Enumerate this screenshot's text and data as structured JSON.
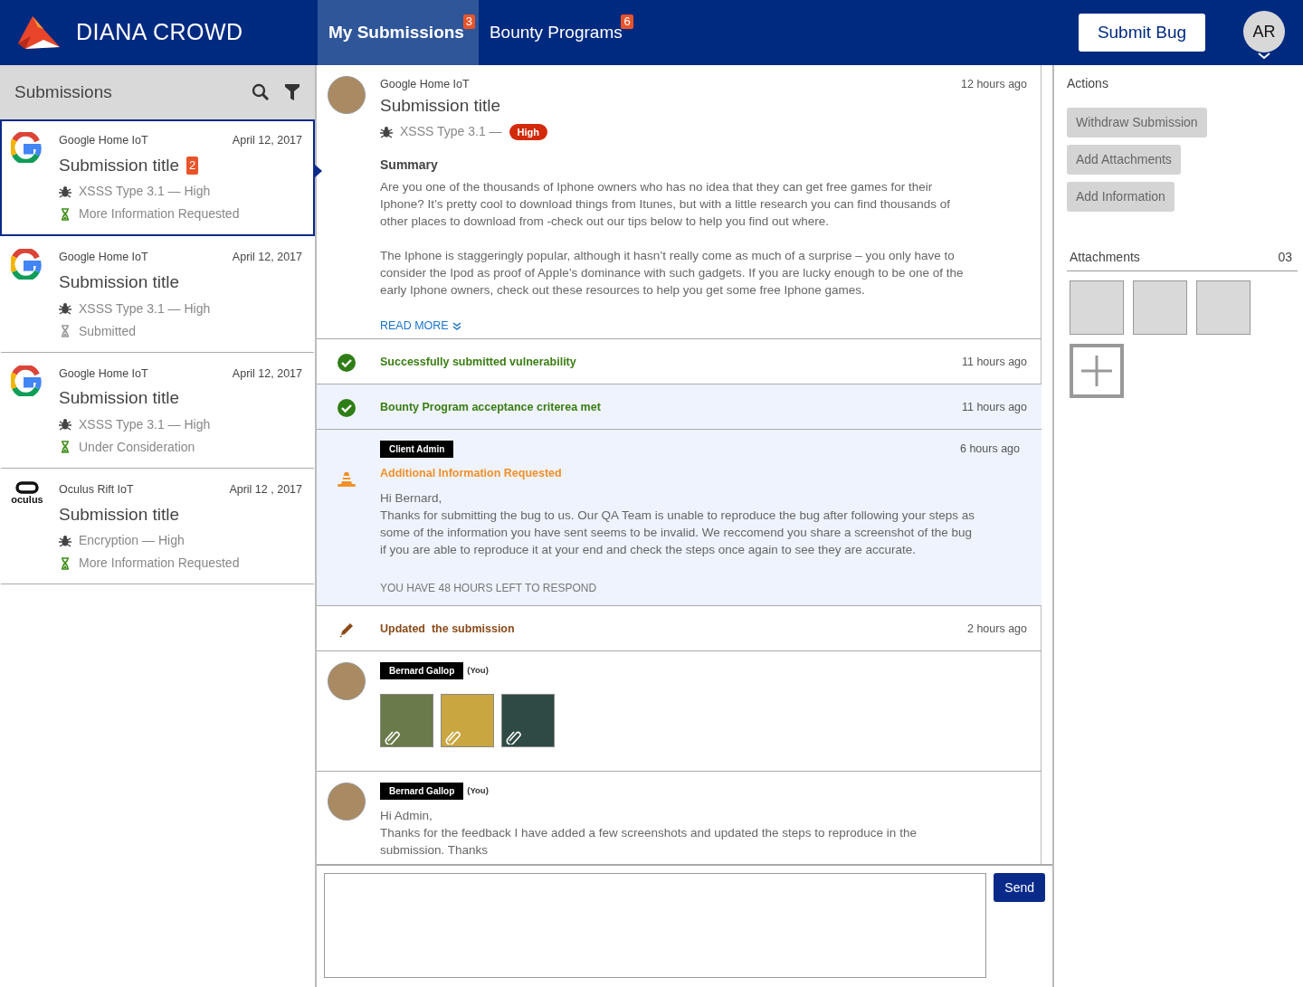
{
  "brand": {
    "name": "DIANA CROWD"
  },
  "nav_tabs": [
    {
      "label": "My Submissions",
      "count": "3",
      "selected": true
    },
    {
      "label": "Bounty Programs",
      "count": "6",
      "selected": false
    }
  ],
  "submit_button": "Submit Bug",
  "avatar_initials": "AR",
  "sidebar": {
    "title": "Submissions",
    "submissions": [
      {
        "kind": "google",
        "program": "Google Home IoT",
        "date": "April 12, 2017",
        "title": "Submission title",
        "count": "2",
        "vuln": "XSSS Type 3.1 — High",
        "status": "More Information Requested",
        "color": "#3f8f1a",
        "selected": true
      },
      {
        "kind": "google",
        "program": "Google Home IoT",
        "date": "April 12, 2017",
        "title": "Submission title",
        "vuln": "XSSS Type 3.1 — High",
        "status": "Submitted",
        "color": "#9a9a9a",
        "selected": false
      },
      {
        "kind": "google",
        "program": "Google Home IoT",
        "date": "April 12, 2017",
        "title": "Submission title",
        "vuln": "XSSS Type 3.1 — High",
        "status": "Under Consideration",
        "color": "#3f8f1a",
        "selected": false
      },
      {
        "kind": "oculus",
        "logo_text": "oculus",
        "program": "Oculus Rift IoT",
        "date": "April 12 , 2017",
        "title": "Submission title",
        "vuln": "Encryption — High",
        "status": "More Information Requested",
        "color": "#3f8f1a",
        "selected": false
      }
    ]
  },
  "detail": {
    "program": "Google Home IoT",
    "time": "12 hours ago",
    "title": "Submission title",
    "vuln": "XSSS Type 3.1 —",
    "severity": "High",
    "summary_heading": "Summary",
    "summary": [
      "Are you one of the thousands of Iphone owners who has no idea that they can get free games for their Iphone? It’s pretty cool to download things from Itunes, but with a little research you can find thousands of other places to download from -check out our tips below to help you find out where.",
      "The Iphone is staggeringly popular, although it hasn’t really come as much of a surprise – you only have to consider the Ipod as proof of Apple’s dominance with such gadgets. If you are lucky enough to be one of the early Iphone owners, check out these resources to help you get some free Iphone games."
    ],
    "read_more": "READ MORE"
  },
  "timeline": [
    {
      "kind": "success",
      "text": "Successfully submitted vulnerability",
      "time": "11 hours ago",
      "highlighted": false
    },
    {
      "kind": "success",
      "text": "Bounty Program acceptance criterea met",
      "time": "11 hours ago",
      "highlighted": true
    },
    {
      "kind": "request",
      "tag": "Client Admin",
      "heading": "Additional Information Requested",
      "lines": [
        "Hi Bernard,",
        "Thanks for submitting the bug to us. Our QA Team is unable to reproduce the bug after following your steps as some of the information you have sent seems to be invalid. We reccomend you share a screenshot of the bug if you are able to reproduce it at your end and check the steps once again to see they are accurate."
      ],
      "deadline": "YOU HAVE 48 HOURS LEFT TO RESPOND",
      "time": "6 hours ago",
      "highlighted": true
    },
    {
      "kind": "update",
      "text": "Updated  the submission",
      "time": "2 hours ago",
      "highlighted": false
    },
    {
      "kind": "photos",
      "author": "Bernard Gallop",
      "you": "(You)",
      "photos": [
        {
          "color": "#6b7a4a"
        },
        {
          "color": "#c9a640"
        },
        {
          "color": "#2f4a44"
        }
      ]
    },
    {
      "kind": "reply",
      "author": "Bernard Gallop",
      "you": "(You)",
      "lines": [
        "Hi Admin,",
        "Thanks for the feedback I have added a few screenshots and updated the steps to reproduce in the submission. Thanks"
      ]
    }
  ],
  "send_button": "Send",
  "actions": {
    "title": "Actions",
    "buttons": [
      "Withdraw Submission",
      "Add Attachments",
      "Add Information"
    ]
  },
  "attachments": {
    "title": "Attachments",
    "count": "03",
    "tiles": [
      {
        "kind": "file"
      },
      {
        "kind": "file"
      },
      {
        "kind": "file"
      },
      {
        "kind": "add"
      }
    ]
  }
}
